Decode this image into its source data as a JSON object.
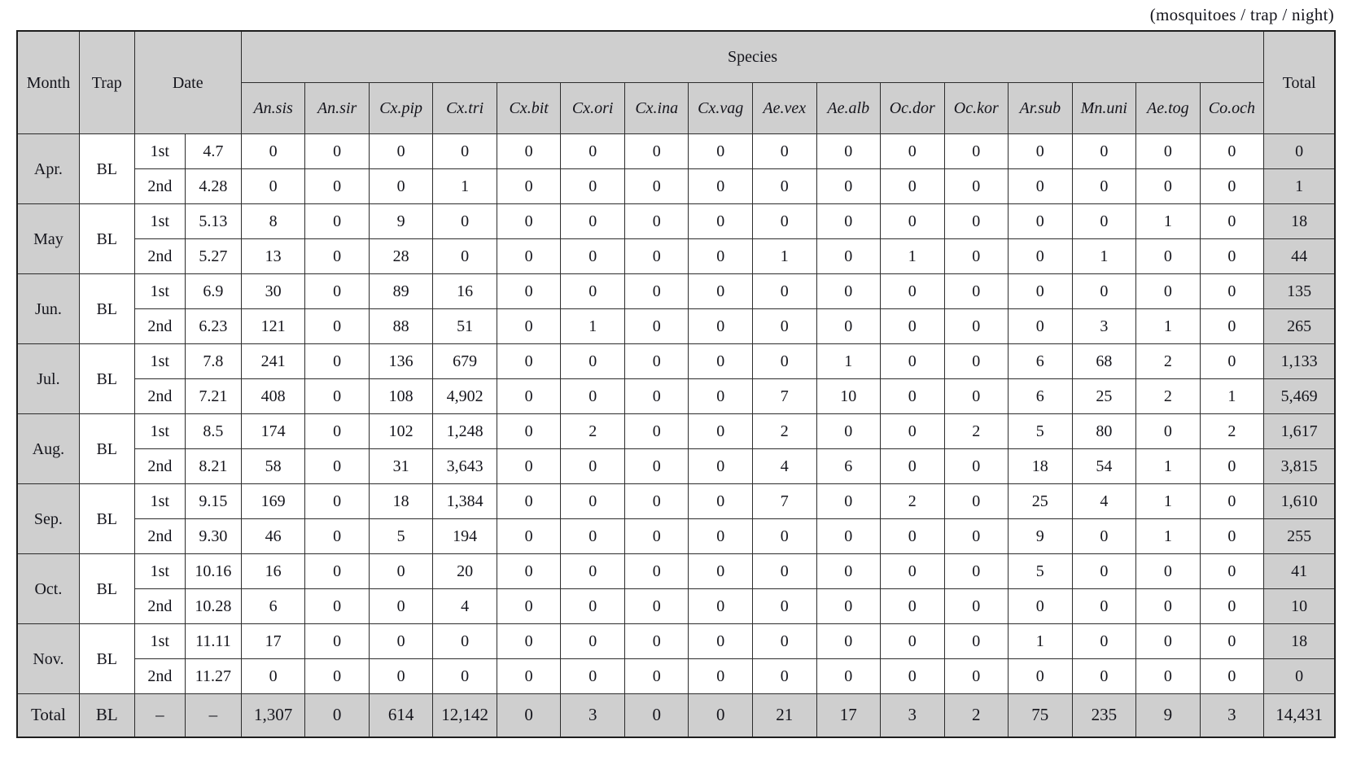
{
  "caption": "(mosquitoes / trap / night)",
  "table": {
    "header": {
      "month": "Month",
      "trap": "Trap",
      "date": "Date",
      "species_group": "Species",
      "total": "Total",
      "species": [
        "An.sis",
        "An.sir",
        "Cx.pip",
        "Cx.tri",
        "Cx.bit",
        "Cx.ori",
        "Cx.ina",
        "Cx.vag",
        "Ae.vex",
        "Ae.alb",
        "Oc.dor",
        "Oc.kor",
        "Ar.sub",
        "Mn.uni",
        "Ae.tog",
        "Co.och"
      ]
    },
    "months": [
      {
        "month": "Apr.",
        "trap": "BL",
        "rows": [
          {
            "seq": "1st",
            "date": "4.7",
            "values": [
              "0",
              "0",
              "0",
              "0",
              "0",
              "0",
              "0",
              "0",
              "0",
              "0",
              "0",
              "0",
              "0",
              "0",
              "0",
              "0"
            ],
            "total": "0"
          },
          {
            "seq": "2nd",
            "date": "4.28",
            "values": [
              "0",
              "0",
              "0",
              "1",
              "0",
              "0",
              "0",
              "0",
              "0",
              "0",
              "0",
              "0",
              "0",
              "0",
              "0",
              "0"
            ],
            "total": "1"
          }
        ]
      },
      {
        "month": "May",
        "trap": "BL",
        "rows": [
          {
            "seq": "1st",
            "date": "5.13",
            "values": [
              "8",
              "0",
              "9",
              "0",
              "0",
              "0",
              "0",
              "0",
              "0",
              "0",
              "0",
              "0",
              "0",
              "0",
              "1",
              "0"
            ],
            "total": "18"
          },
          {
            "seq": "2nd",
            "date": "5.27",
            "values": [
              "13",
              "0",
              "28",
              "0",
              "0",
              "0",
              "0",
              "0",
              "1",
              "0",
              "1",
              "0",
              "0",
              "1",
              "0",
              "0"
            ],
            "total": "44"
          }
        ]
      },
      {
        "month": "Jun.",
        "trap": "BL",
        "rows": [
          {
            "seq": "1st",
            "date": "6.9",
            "values": [
              "30",
              "0",
              "89",
              "16",
              "0",
              "0",
              "0",
              "0",
              "0",
              "0",
              "0",
              "0",
              "0",
              "0",
              "0",
              "0"
            ],
            "total": "135"
          },
          {
            "seq": "2nd",
            "date": "6.23",
            "values": [
              "121",
              "0",
              "88",
              "51",
              "0",
              "1",
              "0",
              "0",
              "0",
              "0",
              "0",
              "0",
              "0",
              "3",
              "1",
              "0"
            ],
            "total": "265"
          }
        ]
      },
      {
        "month": "Jul.",
        "trap": "BL",
        "rows": [
          {
            "seq": "1st",
            "date": "7.8",
            "values": [
              "241",
              "0",
              "136",
              "679",
              "0",
              "0",
              "0",
              "0",
              "0",
              "1",
              "0",
              "0",
              "6",
              "68",
              "2",
              "0"
            ],
            "total": "1,133"
          },
          {
            "seq": "2nd",
            "date": "7.21",
            "values": [
              "408",
              "0",
              "108",
              "4,902",
              "0",
              "0",
              "0",
              "0",
              "7",
              "10",
              "0",
              "0",
              "6",
              "25",
              "2",
              "1"
            ],
            "total": "5,469"
          }
        ]
      },
      {
        "month": "Aug.",
        "trap": "BL",
        "rows": [
          {
            "seq": "1st",
            "date": "8.5",
            "values": [
              "174",
              "0",
              "102",
              "1,248",
              "0",
              "2",
              "0",
              "0",
              "2",
              "0",
              "0",
              "2",
              "5",
              "80",
              "0",
              "2"
            ],
            "total": "1,617"
          },
          {
            "seq": "2nd",
            "date": "8.21",
            "values": [
              "58",
              "0",
              "31",
              "3,643",
              "0",
              "0",
              "0",
              "0",
              "4",
              "6",
              "0",
              "0",
              "18",
              "54",
              "1",
              "0"
            ],
            "total": "3,815"
          }
        ]
      },
      {
        "month": "Sep.",
        "trap": "BL",
        "rows": [
          {
            "seq": "1st",
            "date": "9.15",
            "values": [
              "169",
              "0",
              "18",
              "1,384",
              "0",
              "0",
              "0",
              "0",
              "7",
              "0",
              "2",
              "0",
              "25",
              "4",
              "1",
              "0"
            ],
            "total": "1,610"
          },
          {
            "seq": "2nd",
            "date": "9.30",
            "values": [
              "46",
              "0",
              "5",
              "194",
              "0",
              "0",
              "0",
              "0",
              "0",
              "0",
              "0",
              "0",
              "9",
              "0",
              "1",
              "0"
            ],
            "total": "255"
          }
        ]
      },
      {
        "month": "Oct.",
        "trap": "BL",
        "rows": [
          {
            "seq": "1st",
            "date": "10.16",
            "values": [
              "16",
              "0",
              "0",
              "20",
              "0",
              "0",
              "0",
              "0",
              "0",
              "0",
              "0",
              "0",
              "5",
              "0",
              "0",
              "0"
            ],
            "total": "41"
          },
          {
            "seq": "2nd",
            "date": "10.28",
            "values": [
              "6",
              "0",
              "0",
              "4",
              "0",
              "0",
              "0",
              "0",
              "0",
              "0",
              "0",
              "0",
              "0",
              "0",
              "0",
              "0"
            ],
            "total": "10"
          }
        ]
      },
      {
        "month": "Nov.",
        "trap": "BL",
        "rows": [
          {
            "seq": "1st",
            "date": "11.11",
            "values": [
              "17",
              "0",
              "0",
              "0",
              "0",
              "0",
              "0",
              "0",
              "0",
              "0",
              "0",
              "0",
              "1",
              "0",
              "0",
              "0"
            ],
            "total": "18"
          },
          {
            "seq": "2nd",
            "date": "11.27",
            "values": [
              "0",
              "0",
              "0",
              "0",
              "0",
              "0",
              "0",
              "0",
              "0",
              "0",
              "0",
              "0",
              "0",
              "0",
              "0",
              "0"
            ],
            "total": "0"
          }
        ]
      }
    ],
    "total_row": {
      "label": "Total",
      "trap": "BL",
      "seq": "–",
      "date": "–",
      "values": [
        "1,307",
        "0",
        "614",
        "12,142",
        "0",
        "3",
        "0",
        "0",
        "21",
        "17",
        "3",
        "2",
        "75",
        "235",
        "9",
        "3"
      ],
      "total": "14,431"
    }
  },
  "colors": {
    "header_bg": "#cfcfcf",
    "border": "#2c2c2c",
    "text": "#15151c",
    "body_bg": "#ffffff"
  }
}
